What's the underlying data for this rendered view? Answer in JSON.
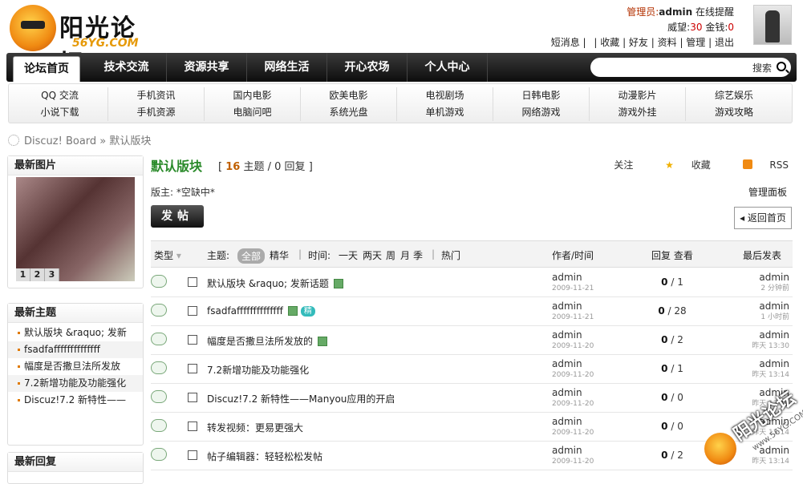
{
  "logo": {
    "text": "阳光论坛",
    "url": "56YG.COM"
  },
  "user": {
    "role": "管理员:",
    "name": "admin",
    "status": "在线提醒",
    "prestige_label": "威望:",
    "prestige": "30",
    "money_label": "金钱:",
    "money": "0",
    "links": [
      "短消息",
      "收藏",
      "好友",
      "资料",
      "管理",
      "退出"
    ]
  },
  "nav": {
    "items": [
      "论坛首页",
      "技术交流",
      "资源共享",
      "网络生活",
      "开心农场",
      "个人中心"
    ],
    "search_label": "搜索"
  },
  "subnav": {
    "row1": [
      "QQ 交流",
      "手机资讯",
      "国内电影",
      "欧美电影",
      "电视剧场",
      "日韩电影",
      "动漫影片",
      "综艺娱乐"
    ],
    "row2": [
      "小说下载",
      "手机资源",
      "电脑问吧",
      "系统光盘",
      "单机游戏",
      "网络游戏",
      "游戏外挂",
      "游戏攻略"
    ]
  },
  "breadcrumb": {
    "home": "Discuz! Board",
    "sep": "»",
    "current": "默认版块"
  },
  "sidebar": {
    "pics_title": "最新图片",
    "pager": [
      "1",
      "2",
      "3"
    ],
    "topics_title": "最新主题",
    "topics": [
      "默认版块 &raquo; 发新",
      "fsadfaffffffffffffff",
      "幅度是否撒旦法所发放",
      "7.2新增功能及功能强化",
      "Discuz!7.2 新特性——"
    ],
    "replies_title": "最新回复"
  },
  "forum": {
    "name": "默认版块",
    "threads": "16",
    "threads_label": "主题",
    "replies": "0",
    "replies_label": "回复",
    "follow": "关注",
    "fav": "收藏",
    "rss": "RSS",
    "moderator": "版主: *空缺中*",
    "mod_panel": "管理面板",
    "post_button": "发帖",
    "back_button": "返回首页"
  },
  "table_header": {
    "type": "类型",
    "subject": "主题:",
    "all": "全部",
    "digest": "精华",
    "time": "时间:",
    "time_opts": [
      "一天",
      "两天",
      "周",
      "月",
      "季"
    ],
    "hot": "热门",
    "author": "作者/时间",
    "stats": "回复 查看",
    "last": "最后发表"
  },
  "threads": [
    {
      "title": "默认版块 &raquo; 发新话题",
      "badge": true,
      "jing": false,
      "author": "admin",
      "date": "2009-11-21",
      "replies": "0",
      "views": "1",
      "last_user": "admin",
      "last_time": "2 分钟前"
    },
    {
      "title": "fsadfaffffffffffffff",
      "badge": true,
      "jing": true,
      "author": "admin",
      "date": "2009-11-21",
      "replies": "0",
      "views": "28",
      "last_user": "admin",
      "last_time": "1 小时前"
    },
    {
      "title": "幅度是否撒旦法所发放的",
      "badge": true,
      "jing": false,
      "author": "admin",
      "date": "2009-11-20",
      "replies": "0",
      "views": "2",
      "last_user": "admin",
      "last_time": "昨天 13:30"
    },
    {
      "title": "7.2新增功能及功能强化",
      "badge": false,
      "jing": false,
      "author": "admin",
      "date": "2009-11-20",
      "replies": "0",
      "views": "1",
      "last_user": "admin",
      "last_time": "昨天 13:14"
    },
    {
      "title": "Discuz!7.2 新特性——Manyou应用的开启",
      "badge": false,
      "jing": false,
      "author": "admin",
      "date": "2009-11-20",
      "replies": "0",
      "views": "0",
      "last_user": "admin",
      "last_time": "昨天 13:14"
    },
    {
      "title": "转发视频：更易更强大",
      "badge": false,
      "jing": false,
      "author": "admin",
      "date": "2009-11-20",
      "replies": "0",
      "views": "0",
      "last_user": "admin",
      "last_time": "昨天 13:14"
    },
    {
      "title": "帖子编辑器：轻轻松松发帖",
      "badge": false,
      "jing": false,
      "author": "admin",
      "date": "2009-11-20",
      "replies": "0",
      "views": "2",
      "last_user": "admin",
      "last_time": "昨天 13:14"
    }
  ],
  "jing_label": "精",
  "watermark": {
    "text": "阳光论坛",
    "url": "www.56YG.COM"
  }
}
